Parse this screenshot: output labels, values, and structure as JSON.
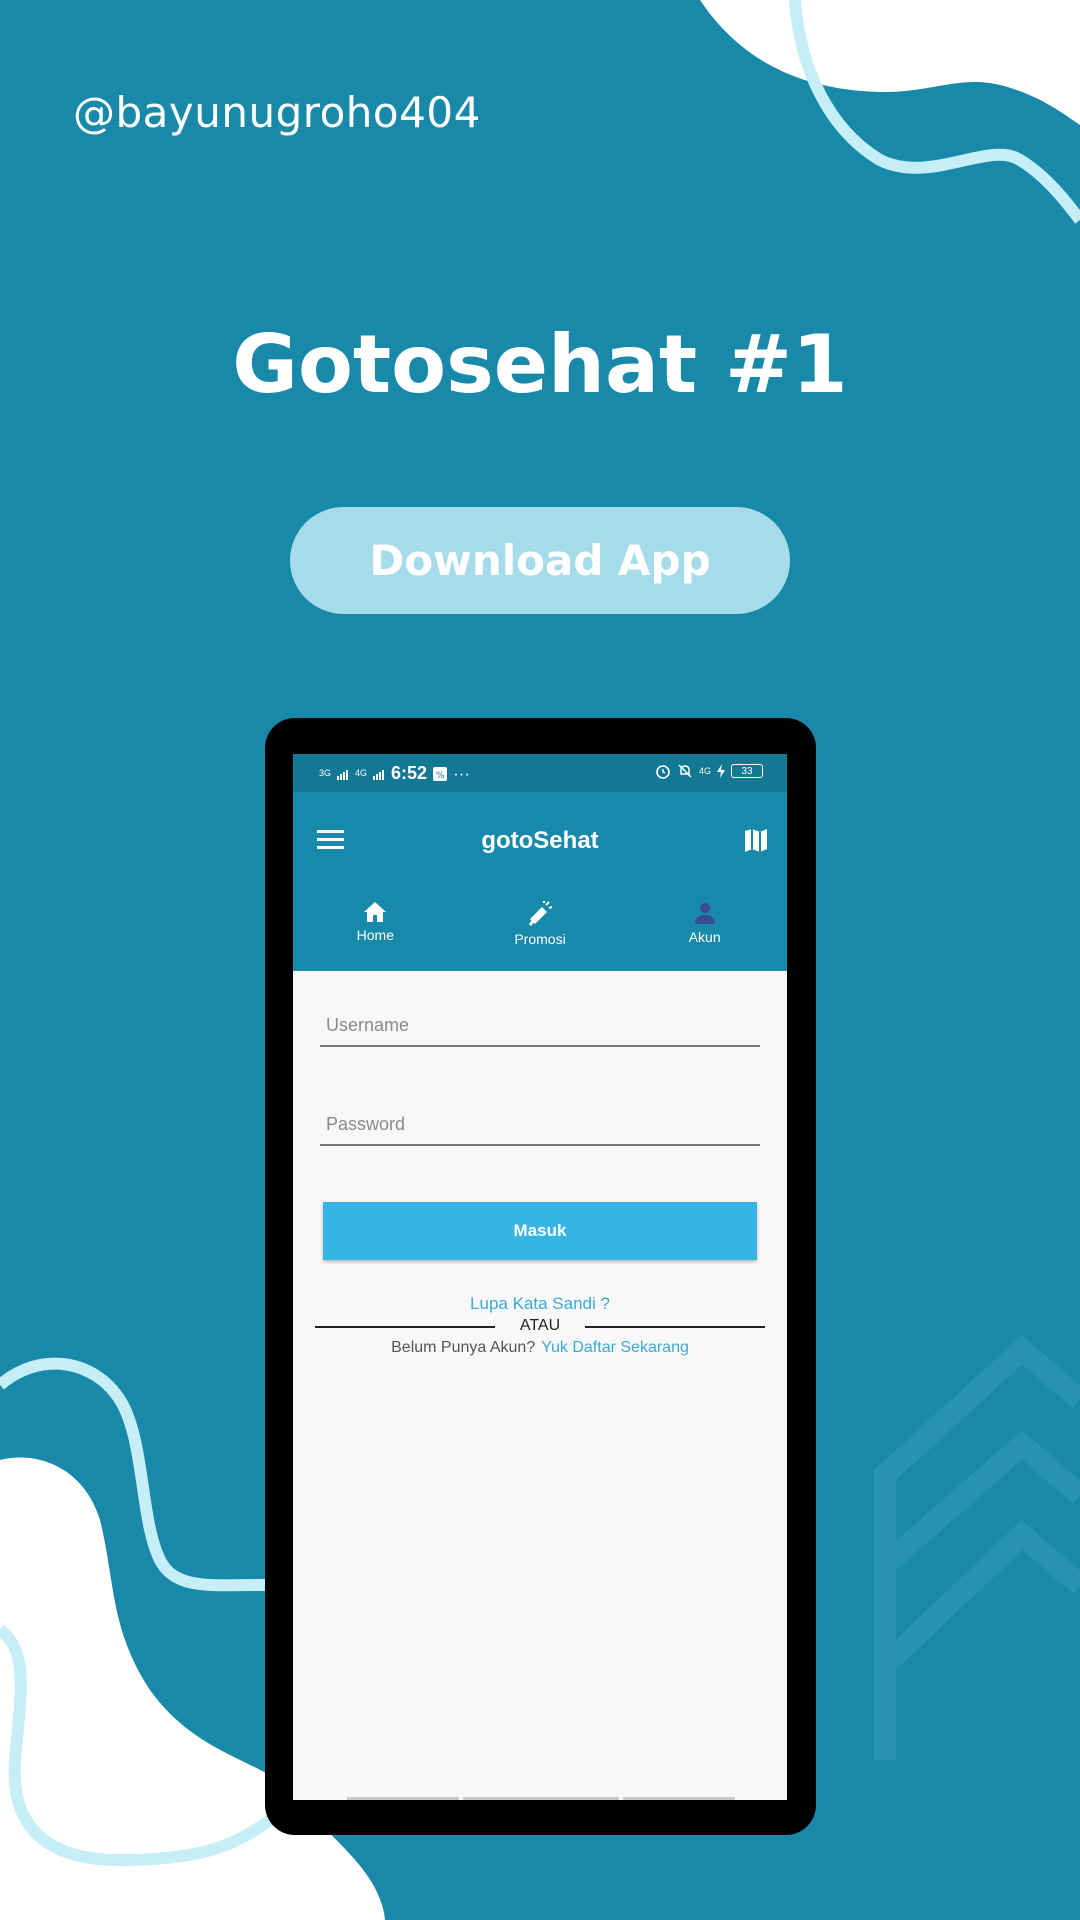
{
  "poster": {
    "handle": "@bayunugroho404",
    "title": "Gotosehat #1",
    "download_label": "Download App",
    "colors": {
      "background": "#1989aa",
      "button": "#a6dcea",
      "accent_line": "#c6eef6"
    }
  },
  "phone": {
    "statusbar": {
      "left_signal_1": "3G",
      "left_signal_2": "4G",
      "time": "6:52",
      "more": "···",
      "network": "4G",
      "battery": "33"
    },
    "appbar": {
      "title": "gotoSehat",
      "menu_icon": "hamburger-icon",
      "map_icon": "map-icon"
    },
    "tabs": [
      {
        "label": "Home",
        "icon": "home-icon"
      },
      {
        "label": "Promosi",
        "icon": "megaphone-icon"
      },
      {
        "label": "Akun",
        "icon": "person-icon"
      }
    ],
    "login": {
      "username_placeholder": "Username",
      "password_placeholder": "Password",
      "submit_label": "Masuk",
      "forgot_label": "Lupa Kata Sandi ?",
      "or_label": "ATAU",
      "no_account_label": "Belum Punya Akun?",
      "register_label": "Yuk Daftar Sekarang"
    }
  }
}
